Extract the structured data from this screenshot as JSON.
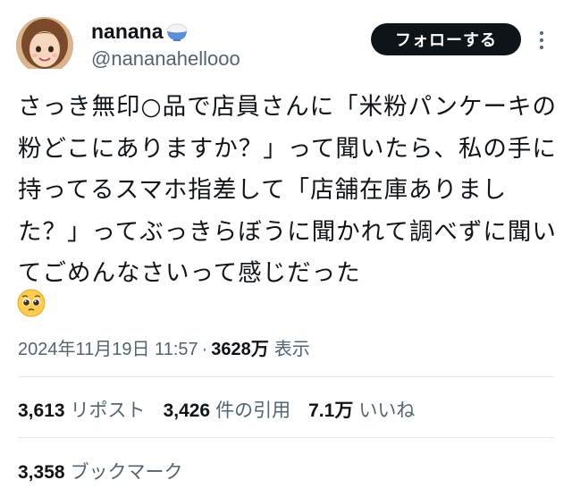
{
  "author": {
    "display_name": "nanana",
    "name_emoji_icon": "rice-bowl-icon",
    "handle": "@nananahellooo",
    "avatar_icon": "avatar"
  },
  "follow_button_label": "フォローする",
  "more_icon": "more-vertical-icon",
  "tweet": {
    "text": "さっき無印○品で店員さんに「米粉パンケーキの粉どこにありますか？」って聞いたら、私の手に持ってるスマホ指差して「店舗在庫ありました？」ってぶっきらぼうに聞かれて調べずに聞いてごめんなさいって感じだった",
    "trailing_emoji": "pleading-face-icon"
  },
  "meta": {
    "timestamp": "2024年11月19日 11:57",
    "separator": "·",
    "views": "3628万",
    "views_label": "表示"
  },
  "stats": {
    "reposts": {
      "num": "3,613",
      "label": "リポスト"
    },
    "quotes": {
      "num": "3,426",
      "label": "件の引用"
    },
    "likes": {
      "num": "7.1万",
      "label": "いいね"
    },
    "bookmarks": {
      "num": "3,358",
      "label": "ブックマーク"
    }
  },
  "colors": {
    "text": "#0f1419",
    "secondary": "#536471",
    "divider": "#e6e9ec",
    "button_bg": "#0f1419"
  }
}
